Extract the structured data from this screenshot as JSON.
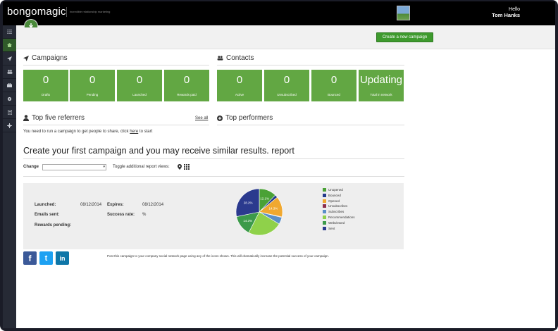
{
  "app": {
    "logo": "bongomagic",
    "tagline": "incredible relationship marketing",
    "greeting": "Hello",
    "user_name": "Tom Hanks"
  },
  "toolbar": {
    "create_campaign_label": "Create a new campaign"
  },
  "sidebar": {
    "items": [
      {
        "icon": "list-icon"
      },
      {
        "icon": "home-icon",
        "active": true
      },
      {
        "icon": "send-icon"
      },
      {
        "icon": "users-icon"
      },
      {
        "icon": "briefcase-icon"
      },
      {
        "icon": "gear-icon"
      },
      {
        "icon": "report-icon"
      },
      {
        "icon": "puzzle-icon"
      }
    ]
  },
  "campaigns": {
    "title": "Campaigns",
    "tiles": [
      {
        "value": "0",
        "label": "Drafts"
      },
      {
        "value": "0",
        "label": "Pending"
      },
      {
        "value": "0",
        "label": "Launched"
      },
      {
        "value": "0",
        "label": "Rewards paid"
      }
    ]
  },
  "contacts": {
    "title": "Contacts",
    "tiles": [
      {
        "value": "0",
        "label": "Active"
      },
      {
        "value": "0",
        "label": "Unsubscribed"
      },
      {
        "value": "0",
        "label": "Bounced"
      },
      {
        "value": "Updating",
        "label": "Total in network"
      }
    ]
  },
  "referrers": {
    "title": "Top five referrers",
    "see_all": "See all",
    "message_prefix": "You need to run a campaign to get people to share, click",
    "message_link": "here",
    "message_suffix": "to start"
  },
  "performers": {
    "title": "Top performers"
  },
  "report": {
    "title": "Create your first campaign and you may receive similar results. report",
    "change_label": "Change",
    "toggle_label": "Toggle additional report views:",
    "launched_label": "Launched:",
    "launched_value": "08/12/2014",
    "expires_label": "Expires:",
    "expires_value": "08/12/2014",
    "emails_sent_label": "Emails sent:",
    "success_rate_label": "Success rate:",
    "success_rate_value": "%",
    "rewards_pending_label": "Rewards pending:"
  },
  "chart_data": {
    "type": "pie",
    "labels": [
      "Unopened",
      "Bounced",
      "Opened",
      "Unsubscribes",
      "Subscribes",
      "Recommendations",
      "Webviewed",
      "Sent"
    ],
    "colors": [
      "#4aa136",
      "#243a8c",
      "#f0a830",
      "#8c2e4e",
      "#5a8fc8",
      "#8fd14a",
      "#3c9a4a",
      "#2b3a8e"
    ],
    "values": [
      12.1,
      2.0,
      14.3,
      0.4,
      4.9,
      23.8,
      14.3,
      28.2
    ],
    "slice_labels": [
      "12.1%",
      "",
      "14.3%",
      "",
      "",
      "",
      "14.3%",
      "28.2%"
    ],
    "legend_position": "right"
  },
  "social": {
    "description": "Post this campaign to your company social network page using any of the icons shown. This will dramatically increase the potential success of your campaign.",
    "facebook_glyph": "f",
    "twitter_glyph": "t",
    "linkedin_glyph": "in"
  }
}
